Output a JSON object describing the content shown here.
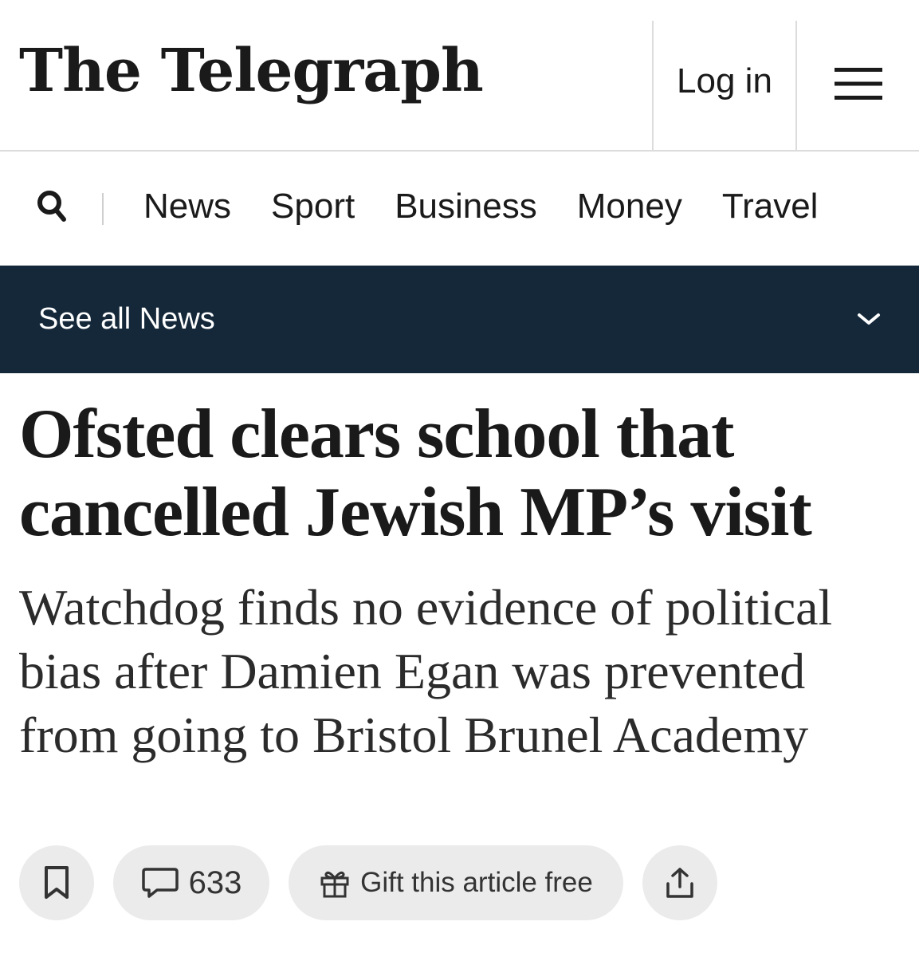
{
  "header": {
    "logo_text": "The Telegraph",
    "login_label": "Log in",
    "menu_icon": "hamburger-menu-icon"
  },
  "nav": {
    "search_icon": "search-icon",
    "items": [
      {
        "label": "News"
      },
      {
        "label": "Sport"
      },
      {
        "label": "Business"
      },
      {
        "label": "Money"
      },
      {
        "label": "Travel"
      }
    ]
  },
  "section_bar": {
    "label": "See all News",
    "icon": "chevron-down-icon",
    "background": "#14283a"
  },
  "article": {
    "headline": "Ofsted clears school that cancelled Jewish MP’s visit",
    "standfirst": "Watchdog finds no evidence of political bias after Damien Egan was prevented from going to Bristol Brunel Academy"
  },
  "actions": {
    "bookmark_icon": "bookmark-icon",
    "comment_icon": "comment-icon",
    "comment_count": "633",
    "gift_icon": "gift-icon",
    "gift_label": "Gift this article free",
    "share_icon": "share-icon"
  }
}
